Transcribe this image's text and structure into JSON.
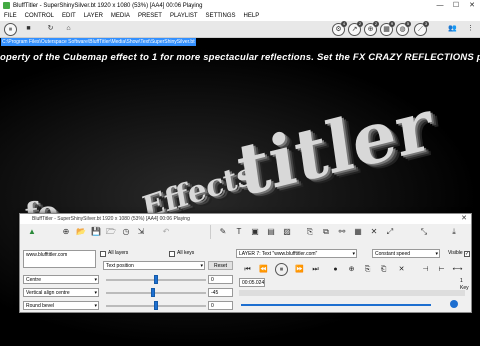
{
  "window": {
    "title": "BluffTitler - SuperShinySilver.bt 1920 x 1080 (53%) [AA4] 00:06 Playing",
    "minimize": "—",
    "maximize": "☐",
    "close": "✕"
  },
  "menu": [
    "FILE",
    "CONTROL",
    "EDIT",
    "LAYER",
    "MEDIA",
    "PRESET",
    "PLAYLIST",
    "SETTINGS",
    "HELP"
  ],
  "toolbar": {
    "play_pause": "⏸",
    "stop": "■",
    "refresh": "↻",
    "home": "⌂",
    "badges": [
      "4",
      "2",
      "2",
      "9",
      "5",
      "3"
    ],
    "people": "👥",
    "more": "⋮"
  },
  "path": "C:\\Program Files\\Outerspace Software\\BluffTitler\\Media\\Show\\Text\\SuperShinySilver.bt",
  "scroller": "operty of the Cubemap effect to 1 for more spectacular reflections.   Set the FX CRAZY REFLECTIONS prop",
  "scene_text": {
    "effects": "Effects",
    "titler": "titler",
    "fo": "fo"
  },
  "dialog": {
    "title": "BluffTitler - SuperShinySilver.bt 1920 x 1080 (53%) [AA4] 00:06 Playing",
    "close": "✕",
    "text_value": "www.blufftitler.com",
    "all_layers": "All layers",
    "all_keys": "All keys",
    "property": "Text position",
    "reset": "Reset",
    "layer": "LAYER  7: Text \"www.blufftitler.com\"",
    "speed": "Constant speed",
    "visible": "Visible",
    "align_h": "Centre",
    "align_v": "Vertical align centre",
    "bevel": "Round bevel",
    "val1": "0",
    "val2": "-45",
    "val3": "0",
    "time": "00:05.024",
    "key_count": "1 Key",
    "slider1": 0.5,
    "slider2": 0.47,
    "slider3": 0.5,
    "timeline": 0.97
  }
}
